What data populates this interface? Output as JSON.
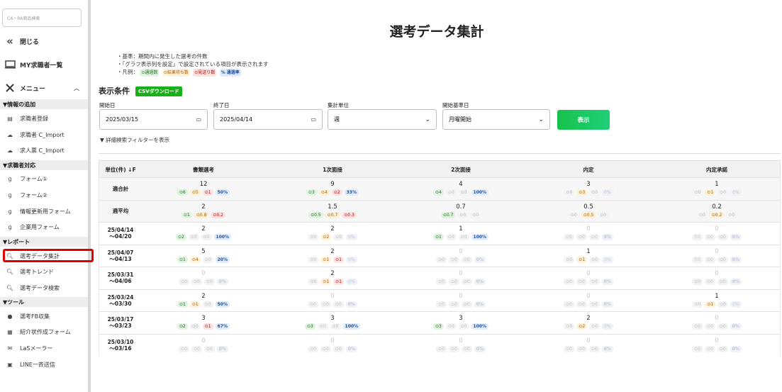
{
  "sidebar": {
    "search_placeholder": "CA・RA商品検索",
    "close_label": "閉じる",
    "my_list_label": "MY求職者一覧",
    "menu_label": "メニュー",
    "sections": [
      {
        "title": "▼情報の追加",
        "items": [
          "求職者登録",
          "求職者 C_Import",
          "求人票 C_Import"
        ]
      },
      {
        "title": "▼求職者対応",
        "items": [
          "フォーム①",
          "フォーム②",
          "情報更新用フォーム",
          "企業用フォーム"
        ]
      },
      {
        "title": "▼レポート",
        "items": [
          "選考データ集計",
          "選考トレンド",
          "選考データ検索"
        ]
      },
      {
        "title": "▼ツール",
        "items": [
          "選考FB収集",
          "紹介状作成フォーム",
          "LaSメーラー",
          "LINE一斉送信"
        ]
      }
    ]
  },
  "main": {
    "title": "選考データ集計",
    "notes": [
      "・基準：期間内に発生した選考の件数",
      "・「グラフ表示列を設定」で設定されている項目が表示されます",
      "・凡例："
    ],
    "legend": [
      "⊙通過数",
      "⊙結果待ち数",
      "⊙見送り数",
      "% 通過率"
    ],
    "conditions_title": "表示条件",
    "csv_label": "CSVダウンロード",
    "fields": {
      "start_label": "開始日",
      "start_value": "2025/03/15",
      "end_label": "終了日",
      "end_value": "2025/04/14",
      "unit_label": "集計単位",
      "unit_value": "週",
      "base_label": "開始基準日",
      "base_value": "月曜開始"
    },
    "show_button": "表示",
    "filter_toggle": "▼ 詳細検索フィルターを表示"
  },
  "table": {
    "unit_header": "単位(件) ↓F",
    "columns": [
      "書類選考",
      "1次面接",
      "2次面接",
      "内定",
      "内定承諾"
    ],
    "rows": [
      {
        "label": "適合計",
        "agg": true,
        "cells": [
          {
            "n": "12",
            "p": [
              "⊙6",
              "⊙5",
              "⊙1",
              "50%"
            ]
          },
          {
            "n": "9",
            "p": [
              "⊙3",
              "⊙4",
              "⊙2",
              "33%"
            ]
          },
          {
            "n": "4",
            "p": [
              "⊙4",
              "⊙0",
              "⊙0",
              "100%"
            ]
          },
          {
            "n": "3",
            "p": [
              "⊙0",
              "⊙3",
              "⊙0",
              "0%"
            ]
          },
          {
            "n": "1",
            "p": [
              "⊙0",
              "⊙1",
              "⊙0",
              "0%"
            ]
          }
        ]
      },
      {
        "label": "週平均",
        "agg": true,
        "cells": [
          {
            "n": "2",
            "p": [
              "⊙1",
              "⊙0.8",
              "⊙0.2"
            ]
          },
          {
            "n": "1.5",
            "p": [
              "⊙0.5",
              "⊙0.7",
              "⊙0.3"
            ]
          },
          {
            "n": "0.7",
            "p": [
              "⊙0.7",
              "⊙0",
              "⊙0"
            ]
          },
          {
            "n": "0.5",
            "p": [
              "⊙0",
              "⊙0.5",
              "⊙0"
            ]
          },
          {
            "n": "0.2",
            "p": [
              "⊙0",
              "⊙0.2",
              "⊙0"
            ]
          }
        ]
      },
      {
        "label": "25/04/14\n～04/20",
        "cells": [
          {
            "n": "2",
            "p": [
              "⊙2",
              "⊙0",
              "⊙0",
              "100%"
            ]
          },
          {
            "n": "2",
            "p": [
              "⊙0",
              "⊙2",
              "⊙0",
              "0%"
            ]
          },
          {
            "n": "1",
            "p": [
              "⊙1",
              "⊙0",
              "⊙0",
              "100%"
            ]
          },
          {
            "n": "0",
            "p": [
              "⊙0",
              "⊙0",
              "⊙0",
              "0%"
            ]
          },
          {
            "n": "0",
            "p": [
              "⊙0",
              "⊙0",
              "⊙0",
              "0%"
            ]
          }
        ]
      },
      {
        "label": "25/04/07\n～04/13",
        "cells": [
          {
            "n": "5",
            "p": [
              "⊙1",
              "⊙4",
              "⊙0",
              "20%"
            ]
          },
          {
            "n": "2",
            "p": [
              "⊙0",
              "⊙1",
              "⊙1",
              "0%"
            ]
          },
          {
            "n": "0",
            "p": [
              "⊙0",
              "⊙0",
              "⊙0",
              "0%"
            ]
          },
          {
            "n": "1",
            "p": [
              "⊙0",
              "⊙1",
              "⊙0",
              "0%"
            ]
          },
          {
            "n": "0",
            "p": [
              "⊙0",
              "⊙0",
              "⊙0",
              "0%"
            ]
          }
        ]
      },
      {
        "label": "25/03/31\n～04/06",
        "cells": [
          {
            "n": "0",
            "p": [
              "⊙0",
              "⊙0",
              "⊙0",
              "0%"
            ]
          },
          {
            "n": "2",
            "p": [
              "⊙0",
              "⊙1",
              "⊙1",
              "0%"
            ]
          },
          {
            "n": "0",
            "p": [
              "⊙0",
              "⊙0",
              "⊙0",
              "0%"
            ]
          },
          {
            "n": "0",
            "p": [
              "⊙0",
              "⊙0",
              "⊙0",
              "0%"
            ]
          },
          {
            "n": "0",
            "p": [
              "⊙0",
              "⊙0",
              "⊙0",
              "0%"
            ]
          }
        ]
      },
      {
        "label": "25/03/24\n～03/30",
        "cells": [
          {
            "n": "2",
            "p": [
              "⊙1",
              "⊙1",
              "⊙0",
              "50%"
            ]
          },
          {
            "n": "0",
            "p": [
              "⊙0",
              "⊙0",
              "⊙0",
              "0%"
            ]
          },
          {
            "n": "0",
            "p": [
              "⊙0",
              "⊙0",
              "⊙0",
              "0%"
            ]
          },
          {
            "n": "0",
            "p": [
              "⊙0",
              "⊙0",
              "⊙0",
              "0%"
            ]
          },
          {
            "n": "1",
            "p": [
              "⊙0",
              "⊙1",
              "⊙0",
              "0%"
            ]
          }
        ]
      },
      {
        "label": "25/03/17\n～03/23",
        "cells": [
          {
            "n": "3",
            "p": [
              "⊙2",
              "⊙0",
              "⊙1",
              "67%"
            ]
          },
          {
            "n": "3",
            "p": [
              "⊙3",
              "⊙0",
              "⊙0",
              "100%"
            ]
          },
          {
            "n": "3",
            "p": [
              "⊙3",
              "⊙0",
              "⊙0",
              "100%"
            ]
          },
          {
            "n": "2",
            "p": [
              "⊙0",
              "⊙2",
              "⊙0",
              "0%"
            ]
          },
          {
            "n": "0",
            "p": [
              "⊙0",
              "⊙0",
              "⊙0",
              "0%"
            ]
          }
        ]
      },
      {
        "label": "25/03/10\n～03/16",
        "cells": [
          {
            "n": "0",
            "p": [
              "⊙0",
              "⊙0",
              "⊙0",
              "0%"
            ]
          },
          {
            "n": "0",
            "p": [
              "⊙0",
              "⊙0",
              "⊙0",
              "0%"
            ]
          },
          {
            "n": "0",
            "p": [
              "⊙0",
              "⊙0",
              "⊙0",
              "0%"
            ]
          },
          {
            "n": "0",
            "p": [
              "⊙0",
              "⊙0",
              "⊙0",
              "0%"
            ]
          },
          {
            "n": "0",
            "p": [
              "⊙0",
              "⊙0",
              "⊙0",
              "0%"
            ]
          }
        ]
      }
    ]
  }
}
